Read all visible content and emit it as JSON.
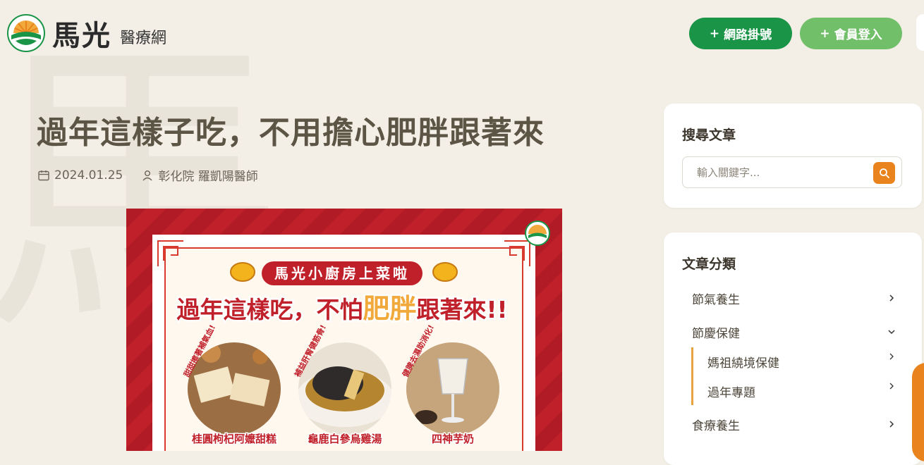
{
  "header": {
    "logo_name": "馬光",
    "logo_sub": "醫療網",
    "register_label": "網路掛號",
    "login_label": "會員登入"
  },
  "article": {
    "title": "過年這樣子吃，不用擔心肥胖跟著來",
    "date": "2024.01.25",
    "author": "彰化院 羅凱陽醫師"
  },
  "poster": {
    "banner": "馬光小廚房上菜啦",
    "headline_a": "過年這樣吃，不怕",
    "headline_b": "肥胖",
    "headline_c": "跟著來!!",
    "dishes": [
      {
        "tagline": "甜甜擦著補氣血!",
        "name": "桂圓枸杞阿嬤甜糕"
      },
      {
        "tagline": "補益肝腎健筋骨!",
        "name": "龜鹿白參烏雞湯"
      },
      {
        "tagline": "健脾去濕助消化!",
        "name": "四神芋奶"
      }
    ]
  },
  "sidebar": {
    "search_title": "搜尋文章",
    "search_placeholder": "輸入關鍵字...",
    "categories_title": "文章分類",
    "categories": [
      "節氣養生",
      "節慶保健",
      "食療養生"
    ],
    "subcategories": [
      "媽祖繞境保健",
      "過年專題"
    ]
  },
  "colors": {
    "brand_green": "#1a9446",
    "light_green": "#72bf6a",
    "accent_orange": "#e8831e",
    "poster_red": "#c0202a"
  }
}
